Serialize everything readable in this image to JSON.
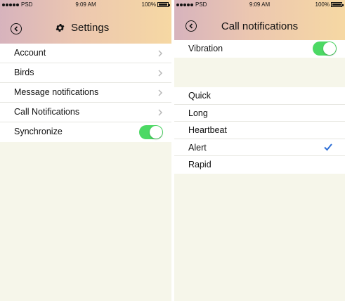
{
  "colors": {
    "toggle_on": "#4cd964",
    "check": "#2f6fd6",
    "background": "#f6f6ea",
    "header_gradient": [
      "#d7b3bd",
      "#f6d8a3"
    ]
  },
  "left": {
    "status": {
      "carrier": "PSD",
      "time": "9:09 AM",
      "battery": "100%"
    },
    "title": "Settings",
    "icons": {
      "back": "back-circle-icon",
      "settings": "gear-icon",
      "chevron": "chevron-right-icon"
    },
    "items": [
      {
        "label": "Account"
      },
      {
        "label": "Birds"
      },
      {
        "label": "Message notifications"
      },
      {
        "label": "Call Notifications"
      }
    ],
    "synchronize": {
      "label": "Synchronize",
      "on": true
    }
  },
  "right": {
    "status": {
      "carrier": "PSD",
      "time": "9:09 AM",
      "battery": "100%"
    },
    "title": "Call notifications",
    "vibration": {
      "label": "Vibration",
      "on": true
    },
    "options": [
      {
        "label": "Quick",
        "selected": false
      },
      {
        "label": "Long",
        "selected": false
      },
      {
        "label": "Heartbeat",
        "selected": false
      },
      {
        "label": "Alert",
        "selected": true
      },
      {
        "label": "Rapid",
        "selected": false
      }
    ]
  }
}
